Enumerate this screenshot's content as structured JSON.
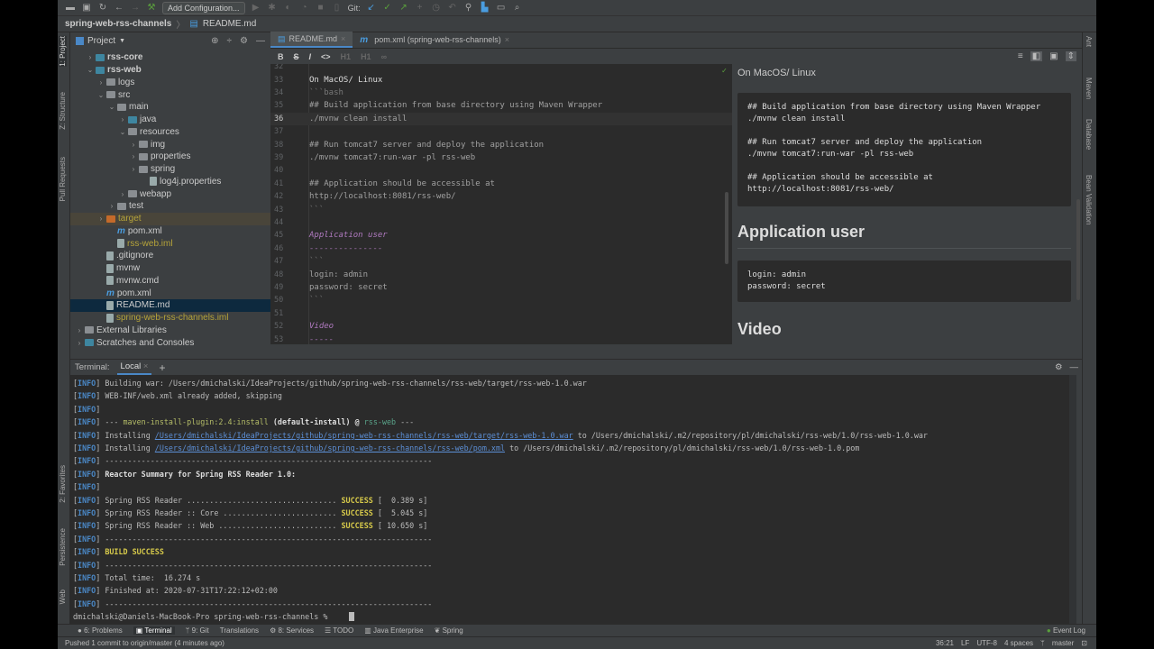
{
  "toolbar": {
    "add_config": "Add Configuration...",
    "git_label": "Git:"
  },
  "breadcrumb": {
    "project": "spring-web-rss-channels",
    "file": "README.md"
  },
  "left_stripe": [
    "1: Project",
    "Z: Structure",
    "Pull Requests",
    "2: Favorites",
    "Persistence",
    "Web"
  ],
  "right_stripe": [
    "Ant",
    "Maven",
    "Database",
    "Bean Validation"
  ],
  "project_panel": {
    "title": "Project",
    "tree": [
      {
        "label": "rss-core",
        "indent": 1,
        "arrow": ">",
        "icon": "module",
        "bold": true
      },
      {
        "label": "rss-web",
        "indent": 1,
        "arrow": "v",
        "icon": "module",
        "bold": true
      },
      {
        "label": "logs",
        "indent": 2,
        "arrow": ">",
        "icon": "folder"
      },
      {
        "label": "src",
        "indent": 2,
        "arrow": "v",
        "icon": "folder"
      },
      {
        "label": "main",
        "indent": 3,
        "arrow": "v",
        "icon": "folder"
      },
      {
        "label": "java",
        "indent": 4,
        "arrow": ">",
        "icon": "folder-blue"
      },
      {
        "label": "resources",
        "indent": 4,
        "arrow": "v",
        "icon": "folder"
      },
      {
        "label": "img",
        "indent": 5,
        "arrow": ">",
        "icon": "folder"
      },
      {
        "label": "properties",
        "indent": 5,
        "arrow": ">",
        "icon": "folder"
      },
      {
        "label": "spring",
        "indent": 5,
        "arrow": ">",
        "icon": "folder"
      },
      {
        "label": "log4j.properties",
        "indent": 6,
        "arrow": "",
        "icon": "file"
      },
      {
        "label": "webapp",
        "indent": 4,
        "arrow": ">",
        "icon": "folder"
      },
      {
        "label": "test",
        "indent": 3,
        "arrow": ">",
        "icon": "folder"
      },
      {
        "label": "target",
        "indent": 2,
        "arrow": ">",
        "icon": "folder-orange",
        "color": "#b5a33a",
        "state": "excluded"
      },
      {
        "label": "pom.xml",
        "indent": 3,
        "arrow": "",
        "icon": "maven"
      },
      {
        "label": "rss-web.iml",
        "indent": 3,
        "arrow": "",
        "icon": "file",
        "color": "#b5a33a"
      },
      {
        "label": ".gitignore",
        "indent": 2,
        "arrow": "",
        "icon": "file"
      },
      {
        "label": "mvnw",
        "indent": 2,
        "arrow": "",
        "icon": "file"
      },
      {
        "label": "mvnw.cmd",
        "indent": 2,
        "arrow": "",
        "icon": "file"
      },
      {
        "label": "pom.xml",
        "indent": 2,
        "arrow": "",
        "icon": "maven"
      },
      {
        "label": "README.md",
        "indent": 2,
        "arrow": "",
        "icon": "file",
        "state": "selected"
      },
      {
        "label": "spring-web-rss-channels.iml",
        "indent": 2,
        "arrow": "",
        "icon": "file",
        "color": "#b5a33a"
      },
      {
        "label": "External Libraries",
        "indent": 0,
        "arrow": ">",
        "icon": "lib"
      },
      {
        "label": "Scratches and Consoles",
        "indent": 0,
        "arrow": ">",
        "icon": "scratch"
      }
    ]
  },
  "editor_tabs": [
    {
      "label": "README.md",
      "active": true
    },
    {
      "label": "pom.xml (spring-web-rss-channels)",
      "active": false
    }
  ],
  "md_toolbar": [
    "B",
    "S",
    "I",
    "<>",
    "H1",
    "H1",
    "link"
  ],
  "editor": {
    "lines": [
      {
        "n": "32",
        "text": "",
        "style": ""
      },
      {
        "n": "33",
        "text": "On MacOS/ Linux",
        "style": "bold"
      },
      {
        "n": "34",
        "text": "```bash",
        "style": "dim"
      },
      {
        "n": "35",
        "text": "## Build application from base directory using Maven Wrapper",
        "style": "comment"
      },
      {
        "n": "36",
        "text": "./mvnw clean install",
        "style": "comment",
        "current": true
      },
      {
        "n": "37",
        "text": "",
        "style": ""
      },
      {
        "n": "38",
        "text": "## Run tomcat7 server and deploy the application",
        "style": "comment"
      },
      {
        "n": "39",
        "text": "./mvnw tomcat7:run-war -pl rss-web",
        "style": "comment"
      },
      {
        "n": "40",
        "text": "",
        "style": ""
      },
      {
        "n": "41",
        "text": "## Application should be accessible at",
        "style": "comment"
      },
      {
        "n": "42",
        "text": "http://localhost:8081/rss-web/",
        "style": "comment"
      },
      {
        "n": "43",
        "text": "```",
        "style": "dim"
      },
      {
        "n": "44",
        "text": "",
        "style": ""
      },
      {
        "n": "45",
        "text": "Application user",
        "style": "head"
      },
      {
        "n": "46",
        "text": "---------------",
        "style": "head"
      },
      {
        "n": "47",
        "text": "```",
        "style": "dim"
      },
      {
        "n": "48",
        "text": "login: admin",
        "style": "comment"
      },
      {
        "n": "49",
        "text": "password: secret",
        "style": "comment"
      },
      {
        "n": "50",
        "text": "```",
        "style": "dim"
      },
      {
        "n": "51",
        "text": "",
        "style": ""
      },
      {
        "n": "52",
        "text": "Video",
        "style": "head"
      },
      {
        "n": "53",
        "text": "-----",
        "style": "head"
      }
    ]
  },
  "preview": {
    "intro": "On MacOS/ Linux",
    "code1": "## Build application from base directory using Maven Wrapper\n./mvnw clean install\n\n## Run tomcat7 server and deploy the application\n./mvnw tomcat7:run-war -pl rss-web\n\n## Application should be accessible at\nhttp://localhost:8081/rss-web/",
    "h_user": "Application user",
    "code2": "login: admin\npassword: secret",
    "h_video": "Video"
  },
  "terminal": {
    "label": "Terminal:",
    "tab": "Local",
    "lines": [
      [
        [
          "Building war: /Users/dmichalski/IdeaProjects/github/spring-web-rss-channels/rss-web/target/rss-web-1.0.war",
          ""
        ]
      ],
      [
        [
          "WEB-INF/web.xml already added, skipping",
          ""
        ]
      ],
      [],
      [
        [
          "--- ",
          ""
        ],
        [
          "maven-install-plugin:2.4:install",
          "yellow"
        ],
        [
          " (default-install) @ ",
          "bold"
        ],
        [
          "rss-web",
          "green"
        ],
        [
          " ---",
          ""
        ]
      ],
      [
        [
          "Installing ",
          ""
        ],
        [
          "/Users/dmichalski/IdeaProjects/github/spring-web-rss-channels/rss-web/target/rss-web-1.0.war",
          "link"
        ],
        [
          " to /Users/dmichalski/.m2/repository/pl/dmichalski/rss-web/1.0/rss-web-1.0.war",
          ""
        ]
      ],
      [
        [
          "Installing ",
          ""
        ],
        [
          "/Users/dmichalski/IdeaProjects/github/spring-web-rss-channels/rss-web/pom.xml",
          "link"
        ],
        [
          " to /Users/dmichalski/.m2/repository/pl/dmichalski/rss-web/1.0/rss-web-1.0.pom",
          ""
        ]
      ],
      [
        [
          "------------------------------------------------------------------------",
          ""
        ]
      ],
      [
        [
          "Reactor Summary for Spring RSS Reader 1.0:",
          "bold"
        ]
      ],
      [],
      [
        [
          "Spring RSS Reader ................................. ",
          ""
        ],
        [
          "SUCCESS",
          "succ"
        ],
        [
          " [  0.389 s]",
          ""
        ]
      ],
      [
        [
          "Spring RSS Reader :: Core ......................... ",
          ""
        ],
        [
          "SUCCESS",
          "succ"
        ],
        [
          " [  5.045 s]",
          ""
        ]
      ],
      [
        [
          "Spring RSS Reader :: Web .......................... ",
          ""
        ],
        [
          "SUCCESS",
          "succ"
        ],
        [
          " [ 10.650 s]",
          ""
        ]
      ],
      [
        [
          "------------------------------------------------------------------------",
          ""
        ]
      ],
      [
        [
          "BUILD SUCCESS",
          "succ"
        ]
      ],
      [
        [
          "------------------------------------------------------------------------",
          ""
        ]
      ],
      [
        [
          "Total time:  16.274 s",
          ""
        ]
      ],
      [
        [
          "Finished at: 2020-07-31T17:22:12+02:00",
          ""
        ]
      ],
      [
        [
          "------------------------------------------------------------------------",
          ""
        ]
      ]
    ],
    "info_tag": "INFO",
    "prompt": "dmichalski@Daniels-MacBook-Pro spring-web-rss-channels % "
  },
  "bottom_tools": [
    "6: Problems",
    "Terminal",
    "9: Git",
    "Translations",
    "8: Services",
    "TODO",
    "Java Enterprise",
    "Spring"
  ],
  "event_log": "Event Log",
  "status": {
    "message": "Pushed 1 commit to origin/master (4 minutes ago)",
    "position": "36:21",
    "line_sep": "LF",
    "encoding": "UTF-8",
    "indent": "4 spaces",
    "branch": "master"
  }
}
